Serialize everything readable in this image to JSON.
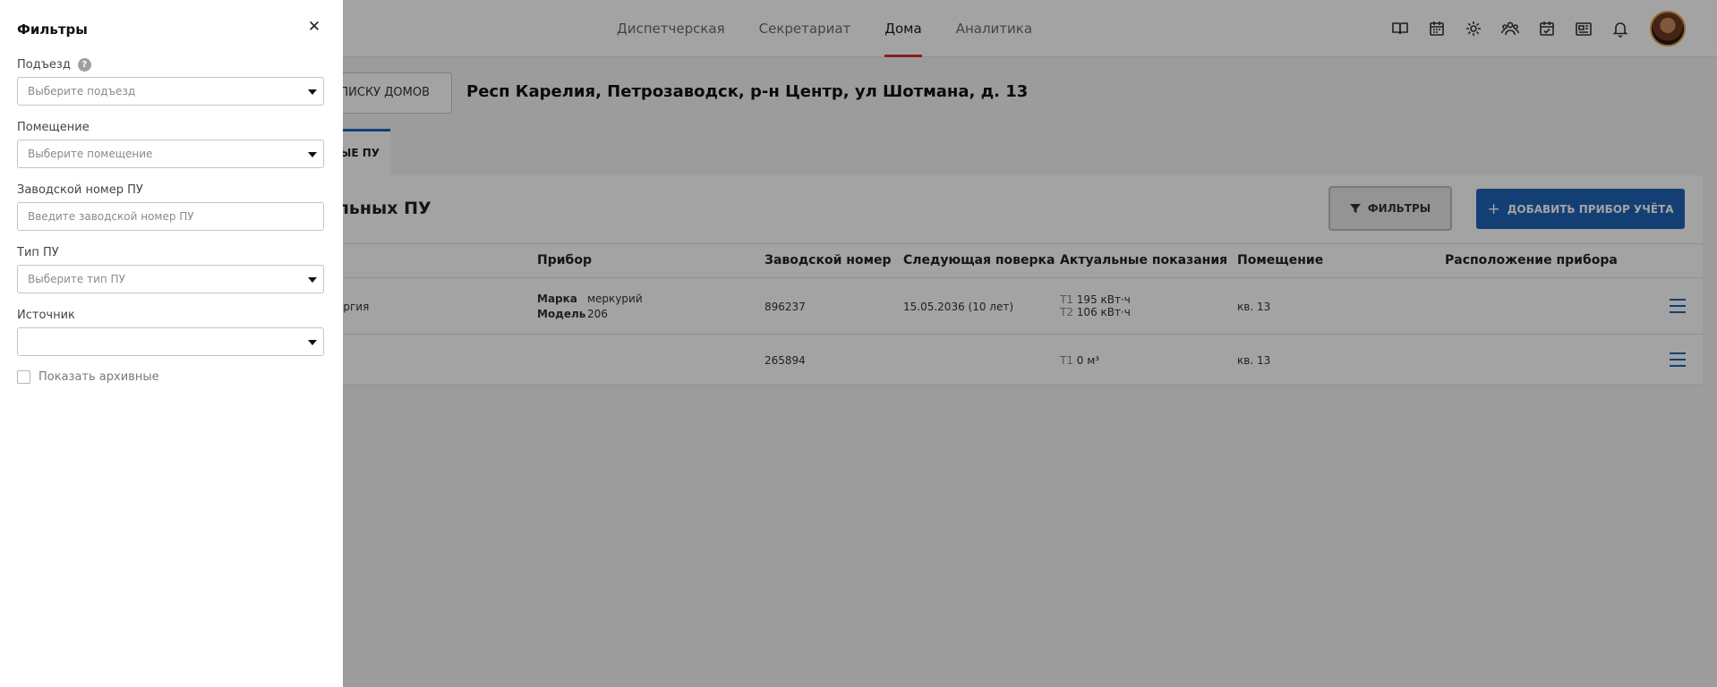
{
  "nav": {
    "items": [
      "Диспетчерская",
      "Секретариат",
      "Дома",
      "Аналитика"
    ],
    "active": "Дома"
  },
  "top_icons": [
    "book-icon",
    "calendar-icon",
    "gear-icon",
    "people-icon",
    "calendar-check-icon",
    "newspaper-icon",
    "bell-icon"
  ],
  "header": {
    "back_button": "СПИСКУ ДОМОВ",
    "address": "Респ Карелия, Петрозаводск, р-н Центр, ул Шотмана, д. 13"
  },
  "tabs": {
    "active_label": "ЫЕ ПУ"
  },
  "card": {
    "title": "льных ПУ",
    "filters_button": "ФИЛЬТРЫ",
    "add_button": "ДОБАВИТЬ ПРИБОР УЧЁТА"
  },
  "table": {
    "headers": [
      "Прибор",
      "Заводской номер",
      "Следующая поверка",
      "Актуальные показания",
      "Помещение",
      "Расположение прибора"
    ],
    "rows": [
      {
        "type": "ергия",
        "brand_label": "Марка",
        "brand": "меркурий",
        "model_label": "Модель",
        "model": "206",
        "serial": "896237",
        "next_check": "15.05.2036 (10 лет)",
        "t1_label": "T1",
        "t1": "195 кВт·ч",
        "t2_label": "T2",
        "t2": "106 кВт·ч",
        "room": "кв. 13",
        "location": ""
      },
      {
        "serial": "265894",
        "t1_label": "T1",
        "t1": "0 м³",
        "room": "кв. 13",
        "location": ""
      }
    ]
  },
  "filters_panel": {
    "title": "Фильтры",
    "fields": {
      "entrance": {
        "label": "Подъезд",
        "placeholder": "Выберите подъезд"
      },
      "premises": {
        "label": "Помещение",
        "placeholder": "Выберите помещение"
      },
      "serial": {
        "label": "Заводской номер ПУ",
        "placeholder": "Введите заводской номер ПУ"
      },
      "type": {
        "label": "Тип ПУ",
        "placeholder": "Выберите тип ПУ"
      },
      "source": {
        "label": "Источник",
        "placeholder": ""
      }
    },
    "show_archived": "Показать архивные",
    "help_glyph": "?"
  },
  "colors": {
    "accent_blue": "#1e63b8",
    "active_nav_underline": "#d32f2f"
  }
}
